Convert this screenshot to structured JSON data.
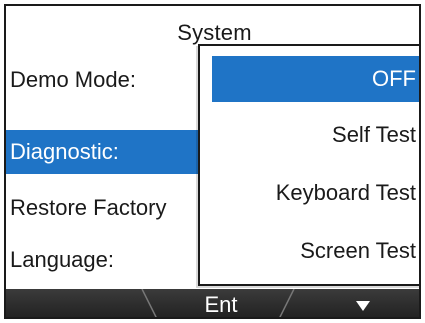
{
  "screen": {
    "title": "System"
  },
  "menu": {
    "items": [
      {
        "label": "Demo Mode:",
        "selected": false
      },
      {
        "label": "Diagnostic:",
        "selected": true
      },
      {
        "label": "Restore Factory",
        "selected": false
      },
      {
        "label": "Language:",
        "selected": false
      }
    ]
  },
  "popup": {
    "options": [
      {
        "label": "OFF",
        "selected": true
      },
      {
        "label": "Self Test",
        "selected": false
      },
      {
        "label": "Keyboard Test",
        "selected": false
      },
      {
        "label": "Screen Test",
        "selected": false
      }
    ]
  },
  "softkeys": {
    "left": "",
    "center": "Ent",
    "right_icon": "down-triangle-icon"
  },
  "colors": {
    "highlight": "#1f74c6",
    "softkey_bar": "#2a2a2a",
    "text": "#1a1a1a"
  }
}
